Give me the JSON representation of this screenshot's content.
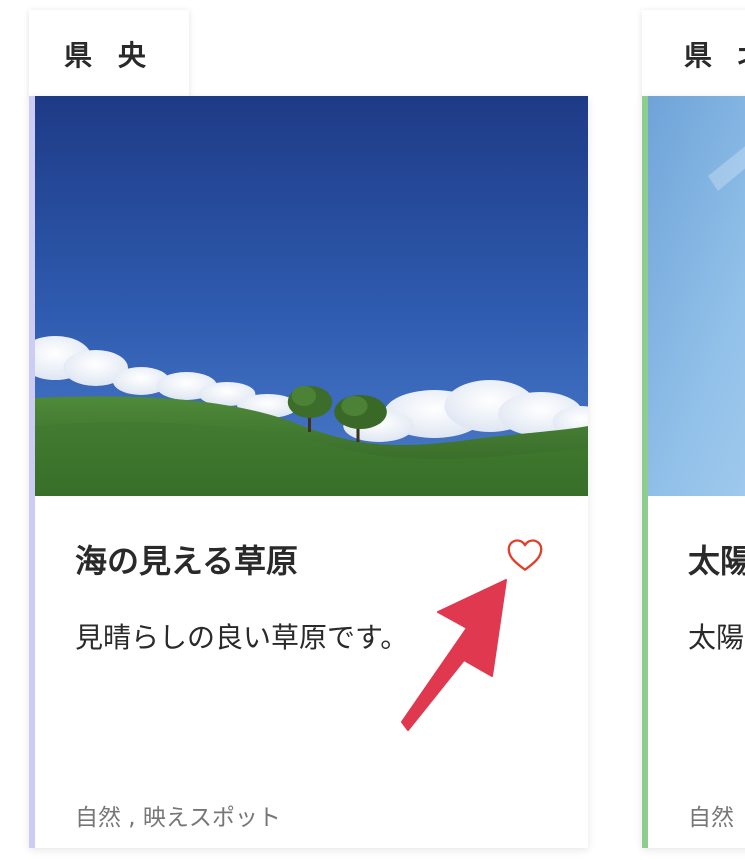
{
  "regions": [
    {
      "tab_label": "県 央"
    },
    {
      "tab_label": "県 北"
    }
  ],
  "cards": [
    {
      "title": "海の見える草原",
      "description": "見晴らしの良い草原です。",
      "tags": "自然 , 映えスポット",
      "accent_color": "#ccccf5",
      "favorited": false
    },
    {
      "title": "太陽",
      "description": "太陽",
      "tags": "自然",
      "accent_color": "#8fcc8f"
    }
  ],
  "icons": {
    "favorite": "heart-outline-icon",
    "annotation": "red-arrow-icon"
  },
  "colors": {
    "heart": "#e0402a",
    "annotation_arrow": "#e0384e"
  }
}
